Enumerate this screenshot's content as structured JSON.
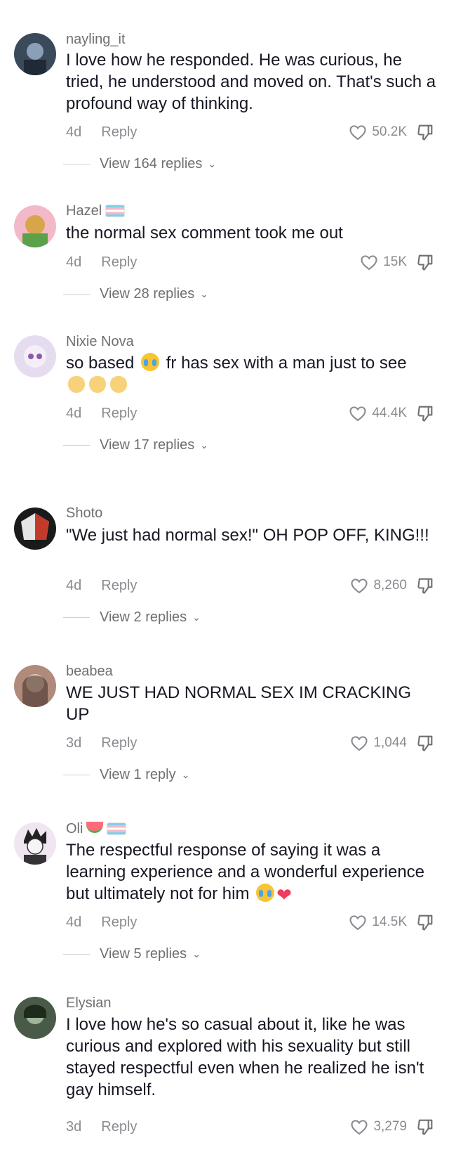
{
  "comments": [
    {
      "username": "nayling_it",
      "text": "I love how he responded. He was curious, he tried, he understood and moved on. That's such a profound way of thinking.",
      "age": "4d",
      "reply_label": "Reply",
      "likes": "50.2K",
      "view_replies": "View 164 replies"
    },
    {
      "username": "Hazel",
      "text": "the normal sex comment took me out",
      "age": "4d",
      "reply_label": "Reply",
      "likes": "15K",
      "view_replies": "View 28 replies"
    },
    {
      "username": "Nixie Nova",
      "text_a": "so based",
      "text_b": "fr has sex with a man just to see",
      "age": "4d",
      "reply_label": "Reply",
      "likes": "44.4K",
      "view_replies": "View 17 replies"
    },
    {
      "username": "Shoto",
      "text": "\"We just had normal sex!\" OH POP OFF, KING!!!",
      "age": "4d",
      "reply_label": "Reply",
      "likes": "8,260",
      "view_replies": "View 2 replies"
    },
    {
      "username": "beabea",
      "text": "WE JUST HAD NORMAL SEX IM CRACKING UP",
      "age": "3d",
      "reply_label": "Reply",
      "likes": "1,044",
      "view_replies": "View 1 reply"
    },
    {
      "username": "Oli",
      "text": "The respectful response of saying it was a learning experience and a wonderful experience but ultimately not for him",
      "age": "4d",
      "reply_label": "Reply",
      "likes": "14.5K",
      "view_replies": "View 5 replies"
    },
    {
      "username": "Elysian",
      "text": "I love how he's so casual about it, like he was curious and explored with his sexuality but still stayed respectful even when he realized he isn't gay himself.",
      "age": "3d",
      "reply_label": "Reply",
      "likes": "3,279"
    }
  ],
  "icons": {
    "like": "heart-outline-icon",
    "dislike": "thumbs-down-icon",
    "expand": "chevron-down-icon",
    "emoji_cry": "loudly-crying-face-emoji",
    "emoji_clap": "clapping-hands-emoji",
    "emoji_heart": "red-heart-emoji",
    "badge_flag": "transgender-flag-emoji",
    "badge_melon": "watermelon-emoji"
  },
  "colors": {
    "text": "#161823",
    "secondary": "#8a8b91",
    "username": "#6f6f6f"
  }
}
